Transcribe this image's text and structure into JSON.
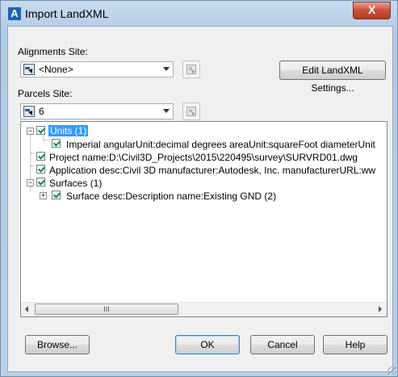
{
  "window": {
    "title": "Import LandXML",
    "app_icon_letter": "A",
    "close_symbol": "X"
  },
  "alignments": {
    "label": "Alignments Site:",
    "value": "<None>"
  },
  "parcels": {
    "label": "Parcels Site:",
    "value": "6"
  },
  "settings_button": "Edit LandXML Settings...",
  "tree": {
    "rows": [
      {
        "text": "Units (1)",
        "selected": true
      },
      {
        "text": "Imperial angularUnit:decimal degrees areaUnit:squareFoot diameterUnit"
      },
      {
        "text": "Project name:D:\\Civil3D_Projects\\2015\\220495\\survey\\SURVRD01.dwg"
      },
      {
        "text": "Application desc:Civil 3D manufacturer:Autodesk, Inc. manufacturerURL:ww"
      },
      {
        "text": "Surfaces (1)"
      },
      {
        "text": "Surface desc:Description name:Existing GND (2)"
      }
    ],
    "scroll_thumb_grip": "III"
  },
  "buttons": {
    "browse": "Browse...",
    "ok": "OK",
    "cancel": "Cancel",
    "help": "Help"
  },
  "icons": {
    "app": "autocad-app-icon",
    "close": "close-icon",
    "site": "site-icon",
    "pick": "pick-from-drawing-icon"
  }
}
